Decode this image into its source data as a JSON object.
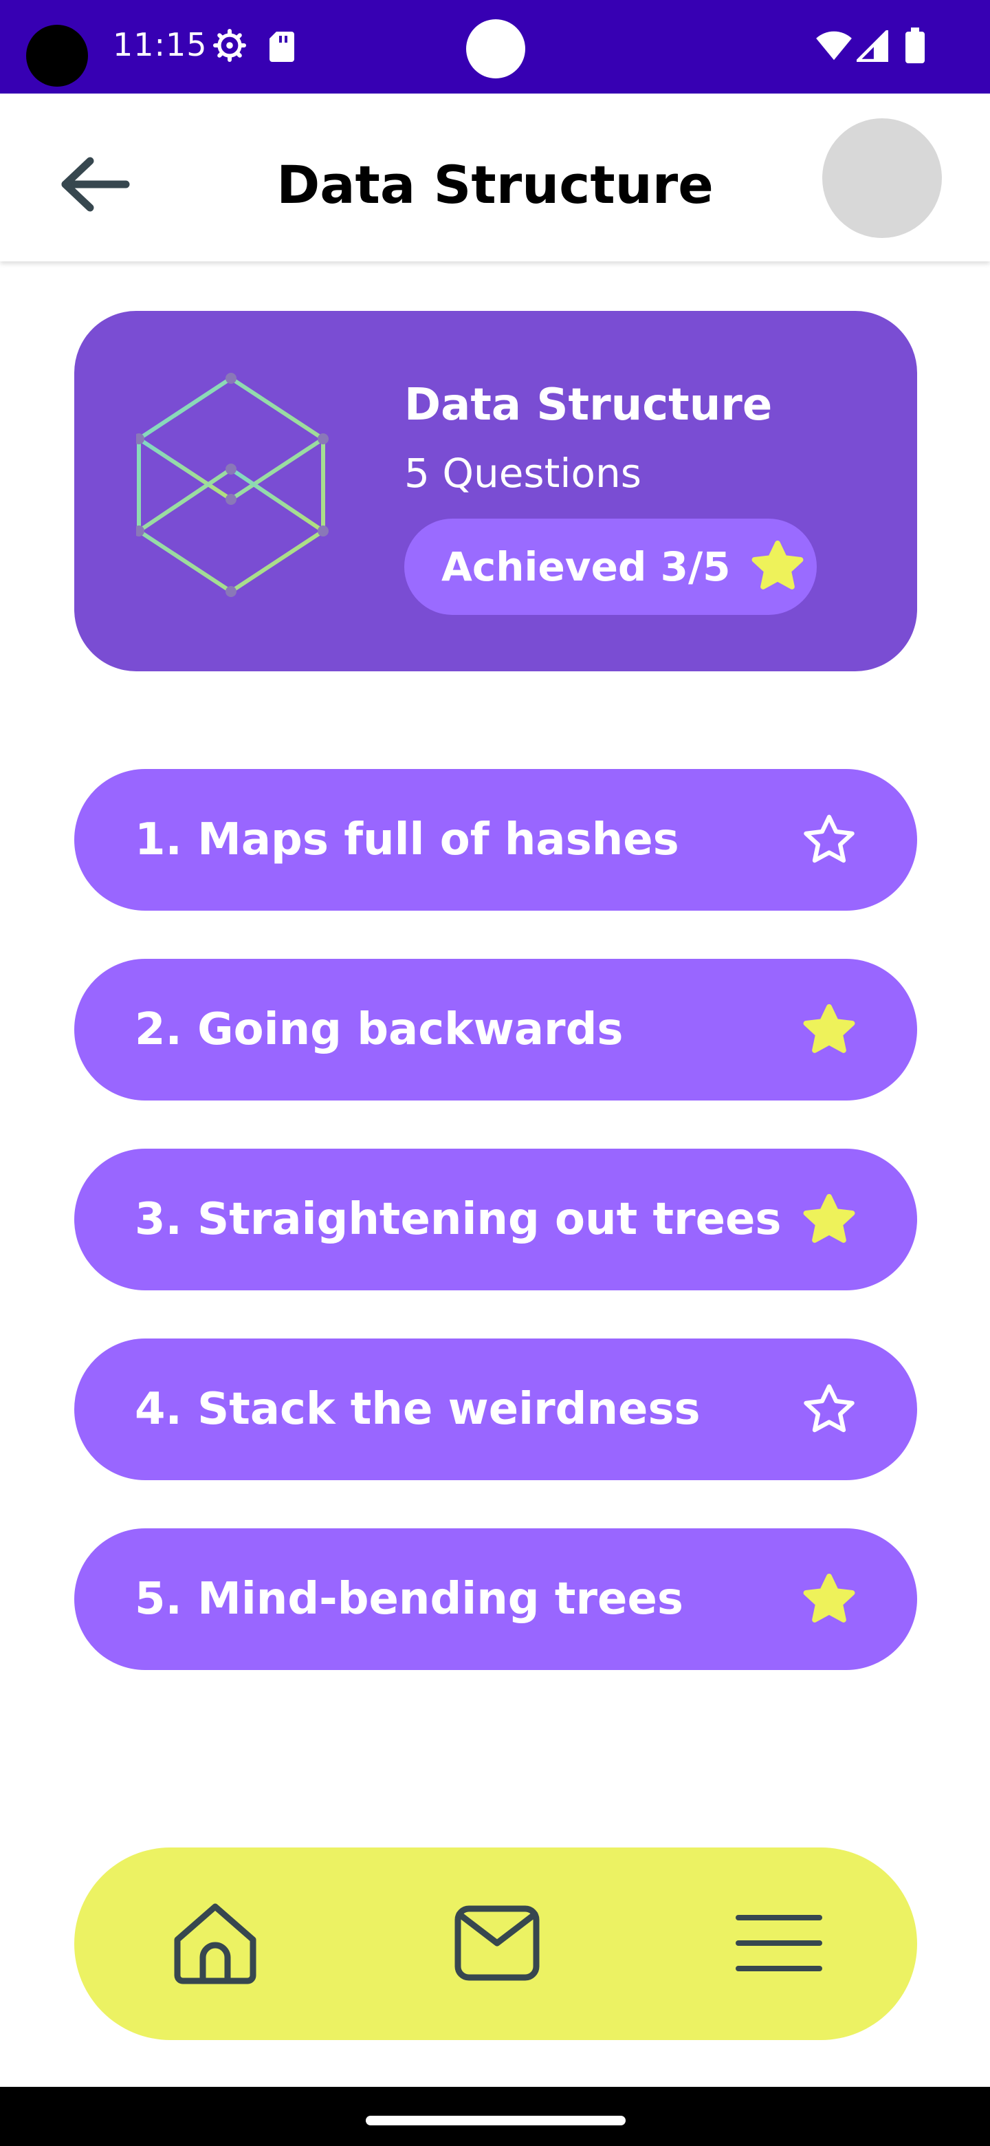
{
  "status_bar": {
    "time": "11:15",
    "icons": [
      "gear-icon",
      "sd-card-icon",
      "wifi-icon",
      "signal-icon",
      "battery-icon"
    ],
    "background": "#3700b3"
  },
  "header": {
    "title": "Data Structure",
    "back_icon": "arrow-left-icon"
  },
  "summary": {
    "title": "Data Structure",
    "subtitle": "5 Questions",
    "achieved_label": "Achieved 3/5",
    "achieved": 3,
    "total": 5,
    "icon": "cube-icon",
    "background": "#7a4dd3"
  },
  "questions": [
    {
      "label": "1. Maps full of hashes",
      "starred": false
    },
    {
      "label": "2. Going backwards",
      "starred": true
    },
    {
      "label": "3. Straightening out trees",
      "starred": true
    },
    {
      "label": "4. Stack the weirdness",
      "starred": false
    },
    {
      "label": "5. Mind-bending trees",
      "starred": true
    }
  ],
  "bottom_nav": {
    "items": [
      "home-icon",
      "mail-icon",
      "menu-icon"
    ],
    "background": "#ecf263"
  },
  "colors": {
    "question_bg": "#9966ff",
    "star_filled": "#eef25a",
    "text_dark": "#37474f"
  }
}
